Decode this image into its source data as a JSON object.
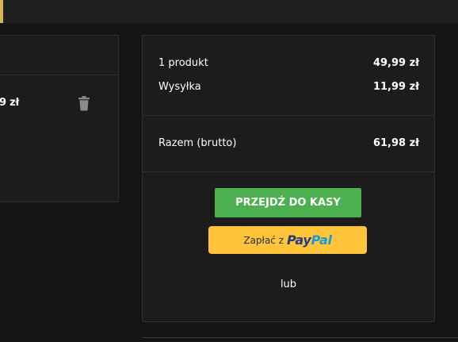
{
  "colors": {
    "background": "#141414",
    "panel": "#1c1c1c",
    "accent": "#d7b35a",
    "checkout_button": "#4caf50",
    "paypal_button": "#ffc439",
    "paypal_dark_blue": "#253b80",
    "paypal_light_blue": "#179bd7"
  },
  "cart": {
    "item_price_partial": "9 zł",
    "delete_icon": "trash-icon"
  },
  "summary": {
    "products_label": "1 produkt",
    "products_value": "49,99 zł",
    "shipping_label": "Wysyłka",
    "shipping_value": "11,99 zł",
    "total_label": "Razem (brutto)",
    "total_value": "61,98 zł",
    "checkout_label": "PRZEJDŹ DO KASY",
    "paypal_prefix": "Zapłać z",
    "paypal_logo_pay": "Pay",
    "paypal_logo_pal": "Pal",
    "or_text": "lub"
  }
}
